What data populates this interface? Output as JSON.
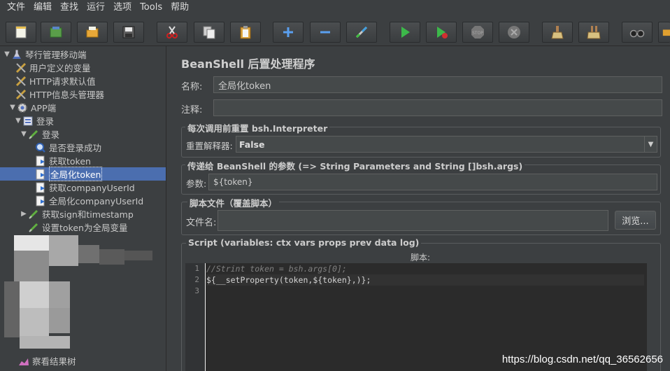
{
  "menu": [
    "文件",
    "编辑",
    "查找",
    "运行",
    "选项",
    "Tools",
    "帮助"
  ],
  "toolbar": [
    "new-icon",
    "templates-icon",
    "open-icon",
    "save-icon",
    "cut-icon",
    "copy-icon",
    "paste-icon",
    "expand-icon",
    "collapse-icon",
    "toggle-icon",
    "start-icon",
    "start-no-pause-icon",
    "stop-icon",
    "shutdown-icon",
    "clear-icon",
    "clear-all-icon",
    "search-icon",
    "reset-search-icon"
  ],
  "tree": {
    "root": "琴行管理移动端",
    "user_vars": "用户定义的变量",
    "http_defaults": "HTTP请求默认值",
    "header_manager": "HTTP信息头管理器",
    "app_group": "APP端",
    "login_controller": "登录",
    "login_sampler": "登录",
    "is_login_ok": "是否登录成功",
    "get_token": "获取token",
    "global_token": "全局化token",
    "get_company_id": "获取companyUserId",
    "global_company_id": "全局化companyUserId",
    "get_sign": "获取sign和timestamp",
    "set_token_global": "设置token为全局变量",
    "view_results": "察看结果树"
  },
  "panel": {
    "title": "BeanShell 后置处理程序",
    "name_label": "名称:",
    "name_value": "全局化token",
    "comment_label": "注释:",
    "comment_value": "",
    "reset_group_title": "每次调用前重置 bsh.Interpreter",
    "reset_label": "重置解释器:",
    "reset_value": "False",
    "params_group_title": "传递给 BeanShell 的参数 (=> String Parameters and String []bsh.args)",
    "params_label": "参数:",
    "params_value": "${token}",
    "file_group_title": "脚本文件（覆盖脚本）",
    "file_label": "文件名:",
    "file_value": "",
    "browse_label": "浏览...",
    "script_group_title": "Script (variables: ctx vars props prev data log)",
    "script_label": "脚本:",
    "line_numbers": [
      "1",
      "2",
      "3"
    ],
    "code_lines": [
      "//Strint token = bsh.args[0];",
      "${__setProperty(token,${token},)};",
      ""
    ]
  },
  "watermark": "https://blog.csdn.net/qq_36562656"
}
